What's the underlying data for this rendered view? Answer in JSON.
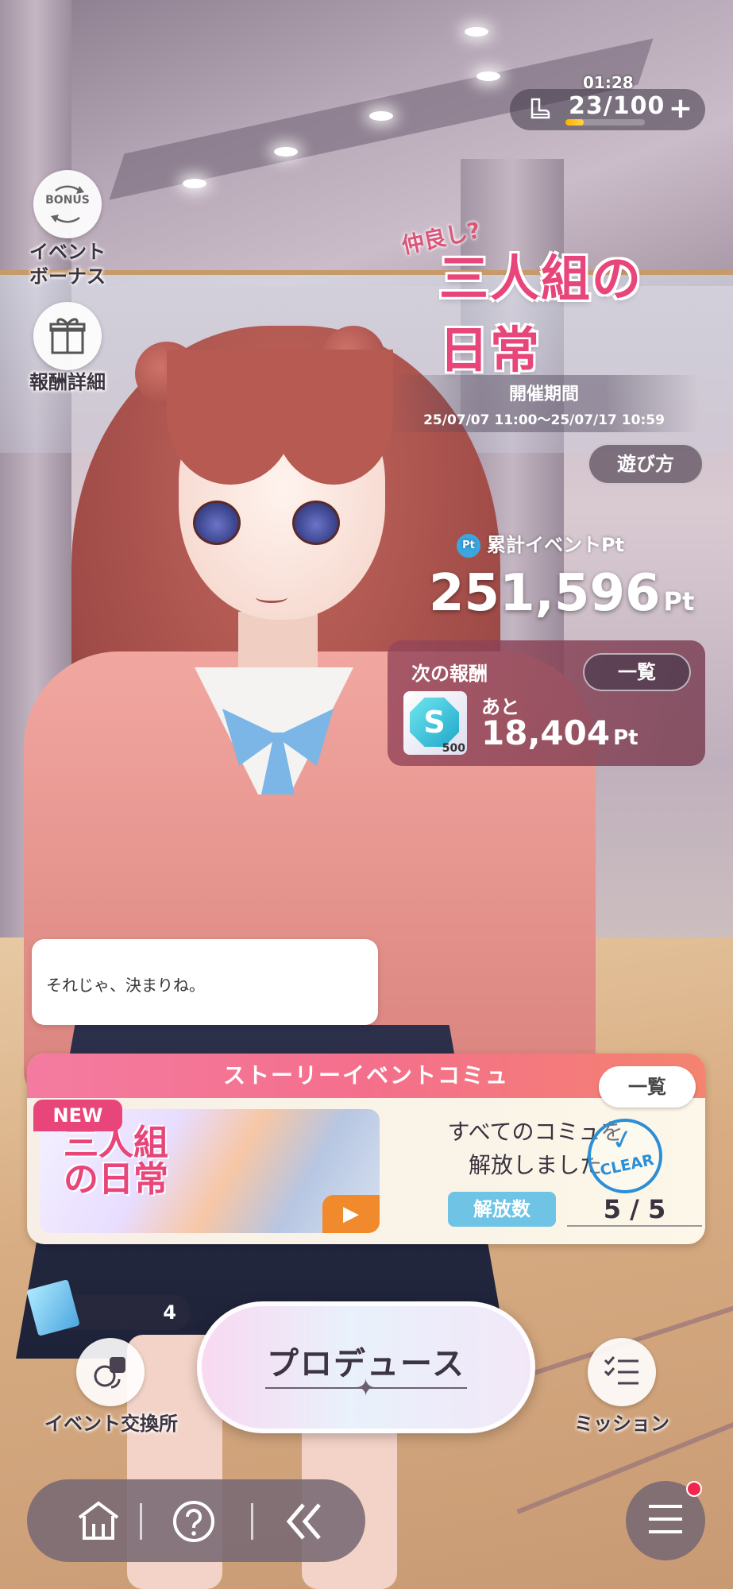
{
  "header": {
    "timer": "01:28",
    "stamina": "23/100",
    "stamina_fraction": 0.23,
    "stamina_plus": "+"
  },
  "side_buttons": {
    "bonus_icon_text": "BONUS",
    "bonus_label": "イベント\nボーナス",
    "reward_detail_label": "報酬詳細"
  },
  "event": {
    "logo_small": "仲良し?",
    "logo_main": "三人組の日常",
    "period_title": "開催期間",
    "period_dates": "25/07/07 11:00～25/07/17 10:59",
    "how_to_play": "遊び方"
  },
  "points": {
    "badge": "Pt",
    "label": "累計イベントPt",
    "value": "251,596",
    "unit": "Pt"
  },
  "next_reward": {
    "title": "次の報酬",
    "list_button": "一覧",
    "item_icon": "S",
    "item_qty": "500",
    "remain_label": "あと",
    "remain_value": "18,404",
    "remain_unit": "Pt"
  },
  "dialog": {
    "text": "それじゃ、決まりね。"
  },
  "story": {
    "title": "ストーリーイベントコミュ",
    "list_button": "一覧",
    "new_badge": "NEW",
    "thumb_title_1": "三人組",
    "thumb_title_2": "の日常",
    "message_line1": "すべてのコミュを",
    "message_line2": "解放しました",
    "clear_stamp": "CLEAR",
    "unlock_label": "解放数",
    "unlock_value": "5 / 5"
  },
  "items": {
    "count": "4"
  },
  "actions": {
    "produce": "プロデュース",
    "exchange_label": "イベント交換所",
    "mission_label": "ミッション"
  },
  "nav": {
    "home_icon": "home-icon",
    "help_icon": "help-icon",
    "back_icon": "back-icon",
    "menu_icon": "menu-icon"
  },
  "colors": {
    "accent_pink": "#e8457a",
    "story_header": "#f47ba0",
    "unlock_blue": "#6fc4e6",
    "notification": "#f0264f"
  }
}
